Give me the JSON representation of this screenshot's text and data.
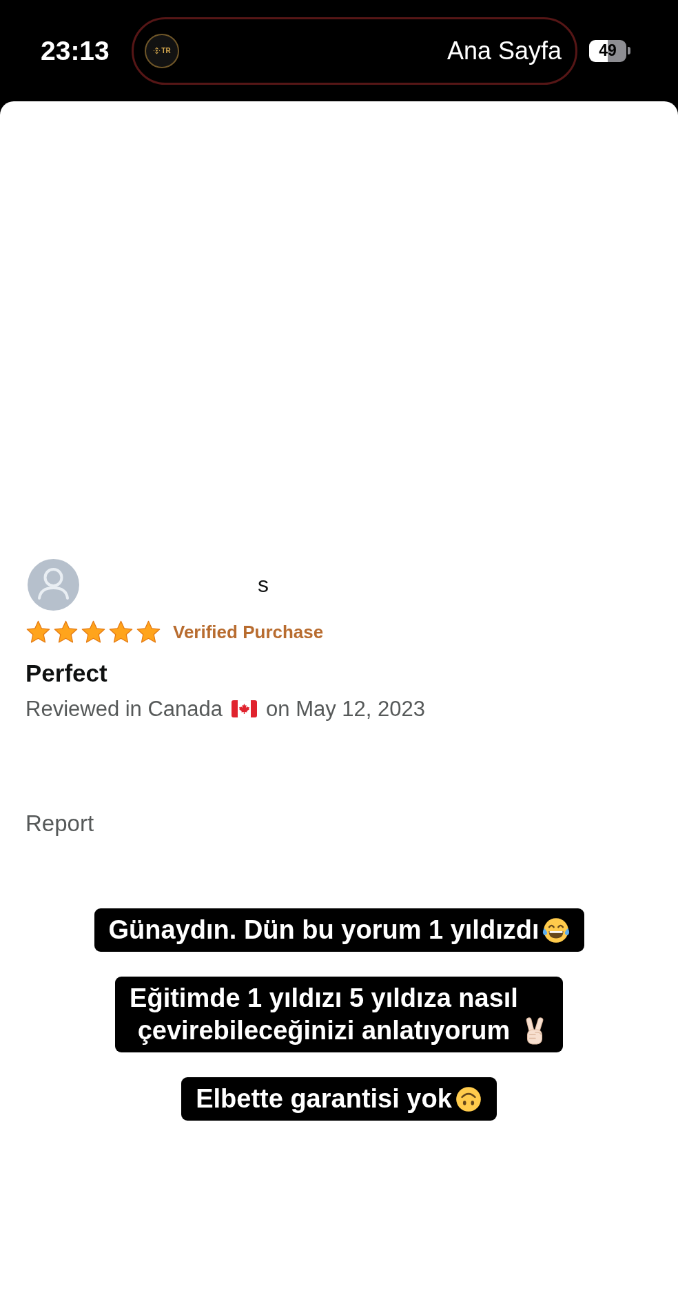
{
  "status_bar": {
    "time": "23:13",
    "live_activity": {
      "logo_text": "TR",
      "title": "Ana Sayfa"
    },
    "battery_text": "49"
  },
  "review": {
    "reviewer_name": "s",
    "stars": 5,
    "badge": "Verified Purchase",
    "title": "Perfect",
    "location_text": "Reviewed in Canada",
    "date_text": "on May 12, 2023",
    "report_link": "Report"
  },
  "captions": [
    "Günaydın. Dün bu yorum 1 yıldızdı",
    "Eğitimde 1 yıldızı 5 yıldıza nasıl çevirebileceğinizi anlatıyorum",
    "Elbette garantisi yok"
  ]
}
